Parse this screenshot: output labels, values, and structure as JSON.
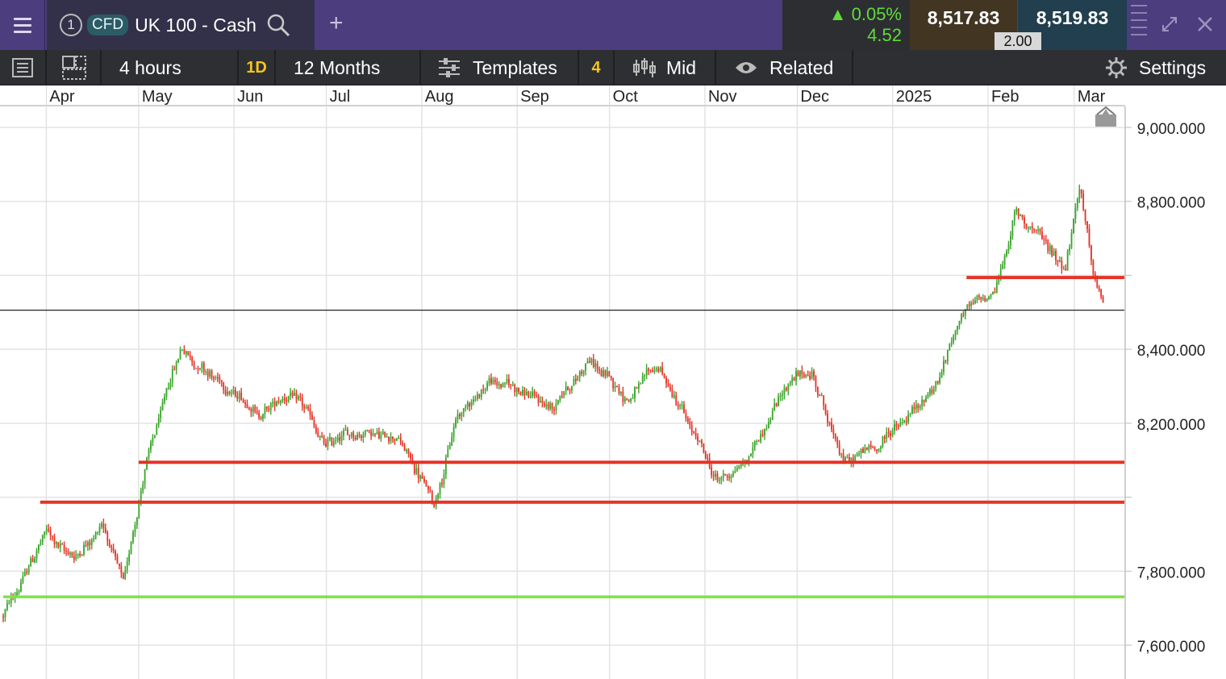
{
  "header": {
    "tab_number": "1",
    "badge": "CFD",
    "instrument": "UK 100 - Cash",
    "change_pct": "0.05%",
    "change_abs": "4.52",
    "sell_price": "8,517.83",
    "buy_price": "8,519.83",
    "spread": "2.00"
  },
  "toolbar": {
    "interval": "4 hours",
    "timeframe_badge": "1D",
    "range": "12 Months",
    "templates": "Templates",
    "indicator_count": "4",
    "price_type": "Mid",
    "related": "Related",
    "settings": "Settings"
  },
  "colors": {
    "up": "#3aa52a",
    "down": "#e53226",
    "support": "#e53226",
    "low_line": "#7fe24a",
    "current": "#b91c10",
    "header_bg": "#4b3d7e"
  },
  "chart_data": {
    "type": "line",
    "series_style": "candlestick",
    "x_labels": [
      "Apr",
      "May",
      "Jun",
      "Jul",
      "Aug",
      "Sep",
      "Oct",
      "Nov",
      "Dec",
      "2025",
      "Feb",
      "Mar"
    ],
    "y_ticks": [
      9000,
      8800,
      8600,
      8400,
      8200,
      8000,
      7800,
      7600
    ],
    "y_tick_labels": [
      "9,000.000",
      "8,800.000",
      "",
      "8,400.000",
      "8,200.000",
      "",
      "7,800.000",
      "7,600.000"
    ],
    "ylim": [
      7550,
      9060
    ],
    "x": [
      "2024-03-18",
      "2024-04-01",
      "2024-04-10",
      "2024-04-19",
      "2024-04-26",
      "2024-05-03",
      "2024-05-15",
      "2024-05-29",
      "2024-06-10",
      "2024-06-20",
      "2024-07-01",
      "2024-07-15",
      "2024-07-24",
      "2024-08-05",
      "2024-08-12",
      "2024-08-23",
      "2024-09-04",
      "2024-09-13",
      "2024-09-24",
      "2024-10-07",
      "2024-10-17",
      "2024-10-30",
      "2024-11-05",
      "2024-11-15",
      "2024-11-26",
      "2024-12-06",
      "2024-12-16",
      "2024-12-27",
      "2025-01-06",
      "2025-01-16",
      "2025-01-23",
      "2025-02-03",
      "2025-02-10",
      "2025-02-18",
      "2025-02-26",
      "2025-03-03",
      "2025-03-07",
      "2025-03-11"
    ],
    "close": [
      7690,
      7920,
      7850,
      7950,
      7780,
      8090,
      8420,
      8300,
      8240,
      8290,
      8150,
      8200,
      8180,
      8000,
      8220,
      8330,
      8300,
      8250,
      8380,
      8280,
      8360,
      8150,
      8050,
      8110,
      8310,
      8350,
      8100,
      8150,
      8240,
      8330,
      8510,
      8560,
      8780,
      8720,
      8640,
      8870,
      8610,
      8520
    ],
    "series": [
      {
        "name": "",
        "price": 8607.232,
        "label": "8,607.232",
        "color": "#e53226",
        "x_start": "2025-01-25"
      },
      {
        "name": "",
        "price": 8518.83,
        "label": "8,518.830",
        "color": "#b91c10"
      },
      {
        "name": "",
        "price": 8107.458,
        "label": "8,107.458",
        "color": "#e53226",
        "x_start": "2024-05-01"
      },
      {
        "name": "",
        "price": 7999.661,
        "label": "7,999.661",
        "color": "#e53226",
        "x_start": "2024-03-30"
      },
      {
        "name": "",
        "price": 7743.672,
        "label": "7,743.672",
        "color": "#7fe24a",
        "x_start": "2024-03-18"
      }
    ],
    "title": "",
    "xlabel": "",
    "ylabel": "",
    "grid": true
  }
}
